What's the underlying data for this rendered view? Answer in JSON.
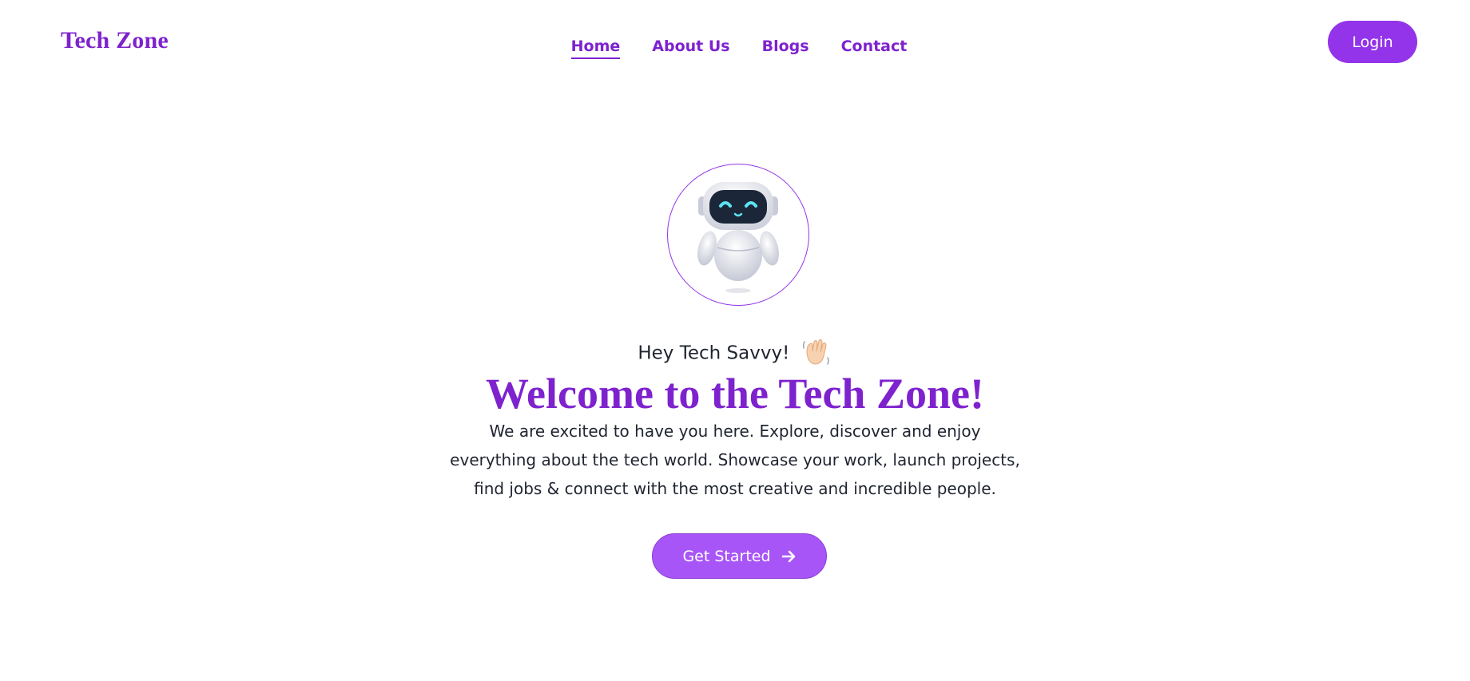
{
  "header": {
    "brand": "Tech Zone",
    "nav": [
      {
        "label": "Home",
        "active": true
      },
      {
        "label": "About Us",
        "active": false
      },
      {
        "label": "Blogs",
        "active": false
      },
      {
        "label": "Contact",
        "active": false
      }
    ],
    "login_label": "Login"
  },
  "hero": {
    "avatar_icon": "robot-icon",
    "greeting": "Hey Tech Savvy!",
    "greeting_icon": "waving-hand-icon",
    "title": "Welcome to the Tech Zone!",
    "description": "We are excited to have you here. Explore, discover and enjoy everything about the tech world. Showcase your work, launch projects, find jobs & connect with the most creative and incredible people.",
    "cta_label": "Get Started",
    "cta_icon": "arrow-right-icon"
  },
  "colors": {
    "accent": "#7e22ce",
    "button": "#9333ea",
    "cta": "#a855f7",
    "text": "#1f2430"
  }
}
